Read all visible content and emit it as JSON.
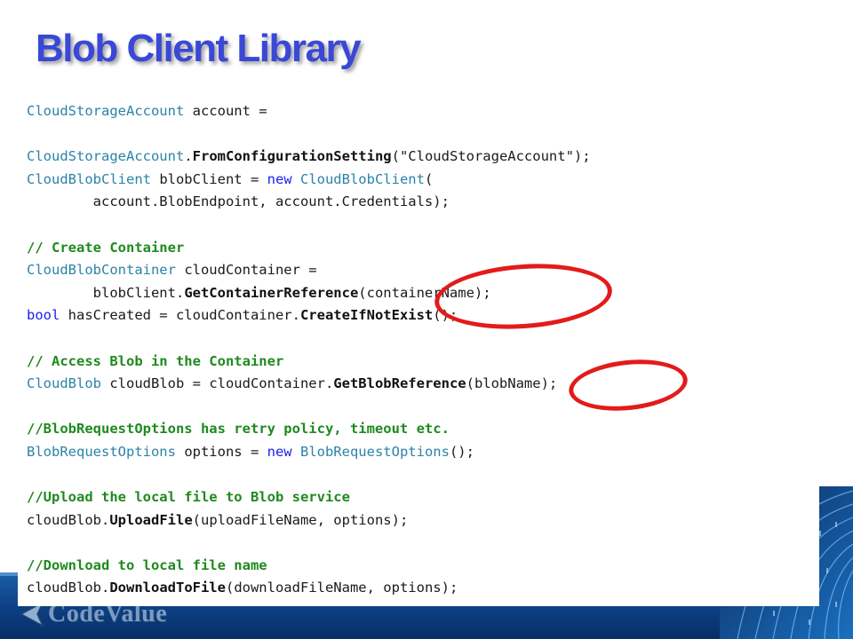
{
  "slide": {
    "title": "Blob Client Library",
    "logo_text": "CodeValue",
    "colors": {
      "title": "#3a48d6",
      "type_name": "#2b83a8",
      "keyword": "#1d1df0",
      "comment": "#1f8a1f",
      "highlight_ring": "#e31b1b",
      "footer_band": "#0c3f82"
    },
    "code_lines": [
      [
        {
          "cls": "t",
          "text": "CloudStorageAccount"
        },
        {
          "cls": "p",
          "text": " account ="
        }
      ],
      [],
      [
        {
          "cls": "t",
          "text": "CloudStorageAccount"
        },
        {
          "cls": "p",
          "text": "."
        },
        {
          "cls": "m",
          "text": "FromConfigurationSetting"
        },
        {
          "cls": "p",
          "text": "(\"CloudStorageAccount\");"
        }
      ],
      [
        {
          "cls": "t",
          "text": "CloudBlobClient"
        },
        {
          "cls": "p",
          "text": " blobClient = "
        },
        {
          "cls": "k",
          "text": "new"
        },
        {
          "cls": "p",
          "text": " "
        },
        {
          "cls": "t",
          "text": "CloudBlobClient"
        },
        {
          "cls": "p",
          "text": "("
        }
      ],
      [
        {
          "cls": "p",
          "text": "        account.BlobEndpoint, account.Credentials);"
        }
      ],
      [],
      [
        {
          "cls": "c",
          "text": "// Create Container"
        }
      ],
      [
        {
          "cls": "t",
          "text": "CloudBlobContainer"
        },
        {
          "cls": "p",
          "text": " cloudContainer ="
        }
      ],
      [
        {
          "cls": "p",
          "text": "        blobClient."
        },
        {
          "cls": "m",
          "text": "GetContainerReference"
        },
        {
          "cls": "p",
          "text": "(containerName);"
        }
      ],
      [
        {
          "cls": "k",
          "text": "bool"
        },
        {
          "cls": "p",
          "text": " hasCreated = cloudContainer."
        },
        {
          "cls": "m",
          "text": "CreateIfNotExist"
        },
        {
          "cls": "p",
          "text": "();"
        }
      ],
      [],
      [
        {
          "cls": "c",
          "text": "// Access Blob in the Container"
        }
      ],
      [
        {
          "cls": "t",
          "text": "CloudBlob"
        },
        {
          "cls": "p",
          "text": " cloudBlob = cloudContainer."
        },
        {
          "cls": "m",
          "text": "GetBlobReference"
        },
        {
          "cls": "p",
          "text": "(blobName);"
        }
      ],
      [],
      [
        {
          "cls": "c",
          "text": "//BlobRequestOptions has retry policy, timeout etc."
        }
      ],
      [
        {
          "cls": "t",
          "text": "BlobRequestOptions"
        },
        {
          "cls": "p",
          "text": " options = "
        },
        {
          "cls": "k",
          "text": "new"
        },
        {
          "cls": "p",
          "text": " "
        },
        {
          "cls": "t",
          "text": "BlobRequestOptions"
        },
        {
          "cls": "p",
          "text": "();"
        }
      ],
      [],
      [
        {
          "cls": "c",
          "text": "//Upload the local file to Blob service"
        }
      ],
      [
        {
          "cls": "p",
          "text": "cloudBlob."
        },
        {
          "cls": "m",
          "text": "UploadFile"
        },
        {
          "cls": "p",
          "text": "(uploadFileName, options);"
        }
      ],
      [],
      [
        {
          "cls": "c",
          "text": "//Download to local file name"
        }
      ],
      [
        {
          "cls": "p",
          "text": "cloudBlob."
        },
        {
          "cls": "m",
          "text": "DownloadToFile"
        },
        {
          "cls": "p",
          "text": "(downloadFileName, options);"
        }
      ]
    ]
  }
}
